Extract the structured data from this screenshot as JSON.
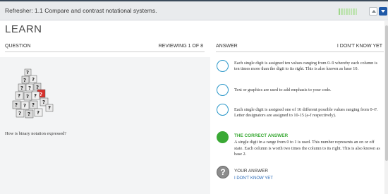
{
  "header": {
    "title": "Refresher: 1.1 Compare and contrast notational systems."
  },
  "page": {
    "heading": "LEARN"
  },
  "question": {
    "section_label": "QUESTION",
    "reviewing": "REVIEWING 1 OF 8",
    "text": "How is binary notation expressed?"
  },
  "answer": {
    "section_label": "ANSWER",
    "dont_know": "I DON'T KNOW YET",
    "choices": [
      {
        "text": "Each single digit is assigned ten values ranging from 0–9 whereby each column is ten times more than the digit to its right. This is also known as base 10."
      },
      {
        "text": "Text or graphics are used to add emphasis to your code."
      },
      {
        "text": "Each single digit is assigned one of 16 different possible values ranging from 0–F. Letter designators are assigned to 10-15 (a-f respectively)."
      },
      {
        "label": "THE CORRECT ANSWER",
        "text": "A single digit in a range from 0 to 1 is used. This number represents an on or off state. Each column is worth two times the column to its right. This is also known as base 2."
      }
    ],
    "your_answer_label": "YOUR ANSWER",
    "your_answer_value": "I DON'T KNOW YET"
  },
  "progress": {
    "completed": 1,
    "total": 8
  },
  "colors": {
    "accent": "#2a97c9",
    "correct": "#3aa935",
    "nav": "#1f5aa8"
  },
  "icons": {
    "correct": "filled-circle-icon",
    "unknown": "question-mark-icon",
    "image": "dice-question-icon"
  }
}
